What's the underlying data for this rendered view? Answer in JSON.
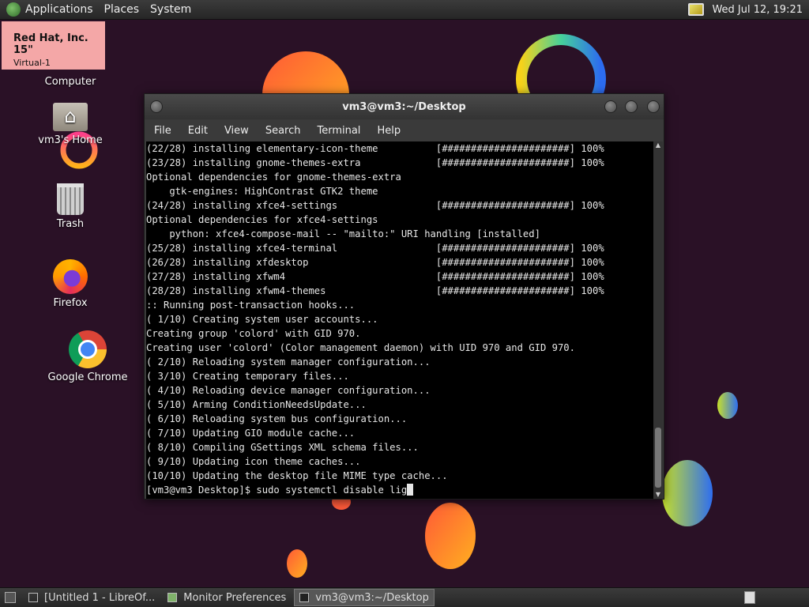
{
  "top_panel": {
    "menus": [
      "Applications",
      "Places",
      "System"
    ],
    "clock": "Wed Jul 12, 19:21"
  },
  "monitor_label": {
    "name": "Red Hat, Inc. 15\"",
    "output": "Virtual-1"
  },
  "desktop_icons": [
    {
      "label": "Computer",
      "icon": "computer-icon"
    },
    {
      "label": "vm3's Home",
      "icon": "home-folder-icon"
    },
    {
      "label": "Trash",
      "icon": "trash-icon"
    },
    {
      "label": "Firefox",
      "icon": "firefox-icon"
    },
    {
      "label": "Google Chrome",
      "icon": "chrome-icon"
    }
  ],
  "terminal": {
    "title": "vm3@vm3:~/Desktop",
    "menu": [
      "File",
      "Edit",
      "View",
      "Search",
      "Terminal",
      "Help"
    ],
    "lines": [
      "(22/28) installing elementary-icon-theme          [######################] 100%",
      "(23/28) installing gnome-themes-extra             [######################] 100%",
      "Optional dependencies for gnome-themes-extra",
      "    gtk-engines: HighContrast GTK2 theme",
      "(24/28) installing xfce4-settings                 [######################] 100%",
      "Optional dependencies for xfce4-settings",
      "    python: xfce4-compose-mail -- \"mailto:\" URI handling [installed]",
      "(25/28) installing xfce4-terminal                 [######################] 100%",
      "(26/28) installing xfdesktop                      [######################] 100%",
      "(27/28) installing xfwm4                          [######################] 100%",
      "(28/28) installing xfwm4-themes                   [######################] 100%",
      ":: Running post-transaction hooks...",
      "( 1/10) Creating system user accounts...",
      "Creating group 'colord' with GID 970.",
      "Creating user 'colord' (Color management daemon) with UID 970 and GID 970.",
      "( 2/10) Reloading system manager configuration...",
      "( 3/10) Creating temporary files...",
      "( 4/10) Reloading device manager configuration...",
      "( 5/10) Arming ConditionNeedsUpdate...",
      "( 6/10) Reloading system bus configuration...",
      "( 7/10) Updating GIO module cache...",
      "( 8/10) Compiling GSettings XML schema files...",
      "( 9/10) Updating icon theme caches...",
      "(10/10) Updating the desktop file MIME type cache..."
    ],
    "prompt": "[vm3@vm3 Desktop]$ sudo systemctl disable lig"
  },
  "taskbar": [
    {
      "label": "[Untitled 1 - LibreOf...",
      "icon": "document-icon",
      "active": false
    },
    {
      "label": "Monitor Preferences",
      "icon": "monitor-icon",
      "active": false
    },
    {
      "label": "vm3@vm3:~/Desktop",
      "icon": "terminal-icon",
      "active": true
    }
  ],
  "colors": {
    "panel": "#2f2f2f",
    "desktop_bg": "#2a1126",
    "terminal_bg": "#000000",
    "notify": "#f4a7a7"
  }
}
